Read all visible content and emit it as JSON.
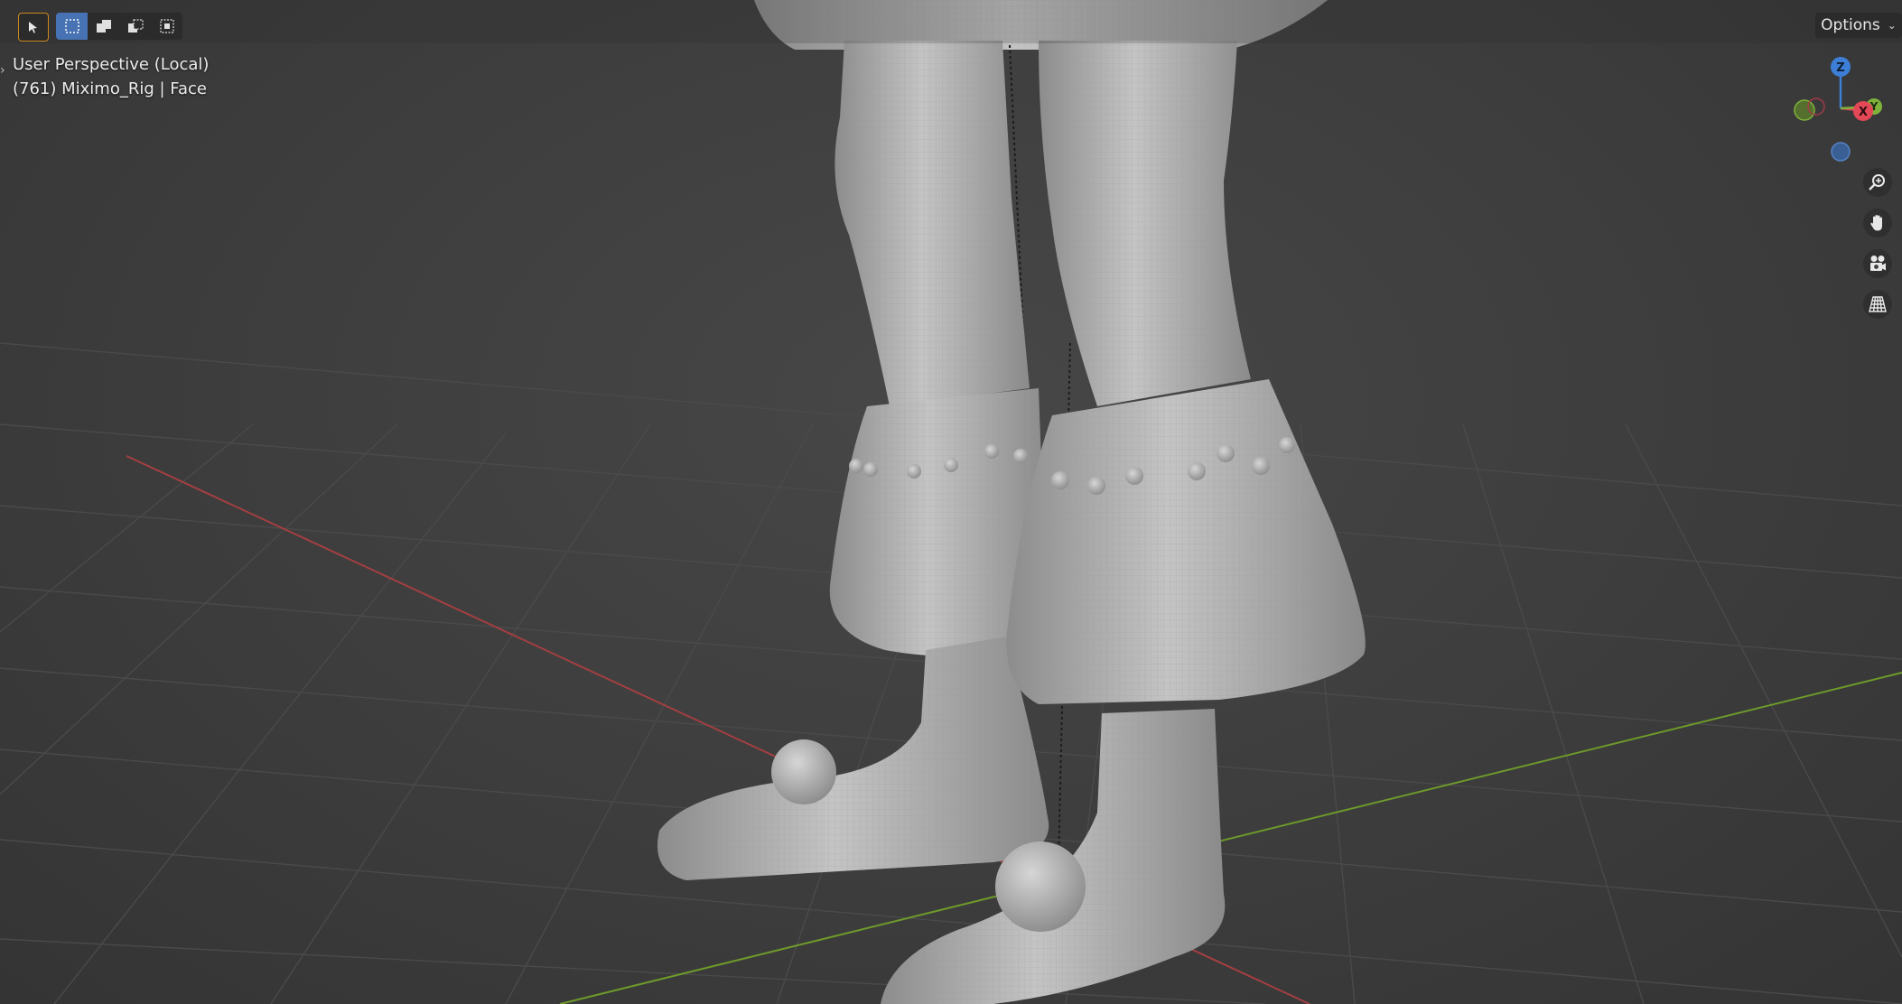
{
  "viewport": {
    "view_name": "User Perspective (Local)",
    "object_info": "(761) Miximo_Rig | Face"
  },
  "header": {
    "options_label": "Options"
  },
  "toolbar": {
    "select_tool_icon": "select-cursor-icon",
    "mode_icons": [
      "select-box-new-icon",
      "select-box-extend-icon",
      "select-box-subtract-icon",
      "select-box-invert-icon",
      "select-box-intersect-icon"
    ]
  },
  "gizmo": {
    "z_label": "Z",
    "x_label": "X",
    "y_label": "Y",
    "colors": {
      "x": "#e34857",
      "y": "#7fb23a",
      "z": "#3d7fd6"
    }
  },
  "navigation": {
    "icons": [
      "zoom-icon",
      "pan-hand-icon",
      "camera-view-icon",
      "perspective-grid-icon"
    ]
  },
  "theme": {
    "background": "#3d3d3d",
    "accent": "#4772b3",
    "x_axis_line": "#a33f42",
    "y_axis_line": "#6e9a2a"
  }
}
